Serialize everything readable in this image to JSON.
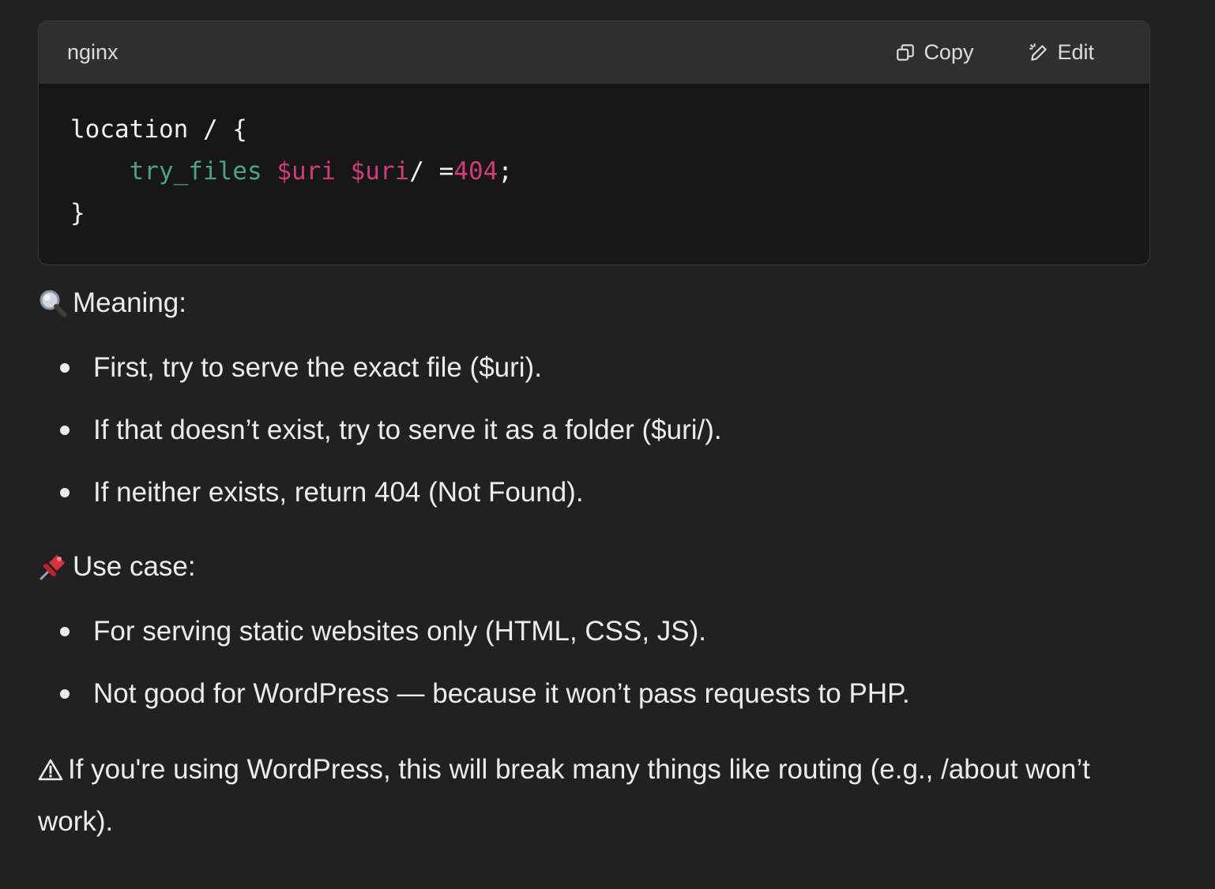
{
  "code_block": {
    "language": "nginx",
    "copy_label": "Copy",
    "edit_label": "Edit",
    "lines": {
      "l1": "location / {",
      "l2_indent": "    ",
      "l2_fn": "try_files",
      "l2_sp1": " ",
      "l2_var1": "$uri",
      "l2_sp2": " ",
      "l2_var2": "$uri",
      "l2_slash": "/ =",
      "l2_num": "404",
      "l2_end": ";",
      "l3": "}"
    }
  },
  "meaning": {
    "heading": "Meaning:",
    "items": [
      "First, try to serve the exact file ($uri).",
      "If that doesn’t exist, try to serve it as a folder ($uri/).",
      "If neither exists, return 404 (Not Found)."
    ]
  },
  "use_case": {
    "heading": "Use case:",
    "items": [
      "For serving static websites only (HTML, CSS, JS).",
      "Not good for WordPress — because it won’t pass requests to PHP."
    ]
  },
  "warning": {
    "text": "If you're using WordPress, this will break many things like routing (e.g., /about won’t work)."
  },
  "icons": {
    "meaning": "magnifying-glass-icon",
    "use_case": "pushpin-icon",
    "warning": "warning-icon",
    "copy": "copy-icon",
    "edit": "edit-icon"
  }
}
